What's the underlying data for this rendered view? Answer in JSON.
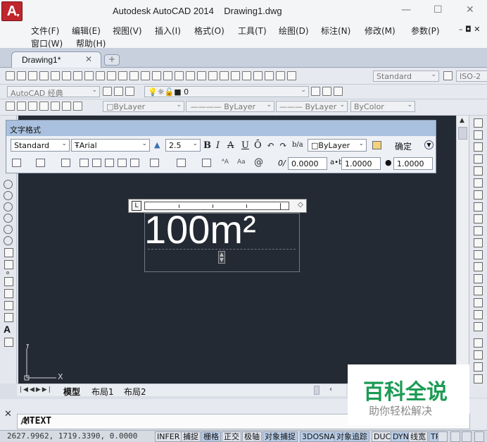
{
  "app": {
    "title": "Autodesk AutoCAD 2014    Drawing1.dwg",
    "logo_letter": "A",
    "brand_color": "#c0262d"
  },
  "window_controls": {
    "minimize": "—",
    "maximize": "☐",
    "close": "✕"
  },
  "menu": {
    "row1": [
      "文件(F)",
      "编辑(E)",
      "视图(V)",
      "插入(I)",
      "格式(O)",
      "工具(T)",
      "绘图(D)",
      "标注(N)",
      "修改(M)",
      "参数(P)"
    ],
    "row2": [
      "窗口(W)",
      "帮助(H)"
    ],
    "doc_controls": "– ◘ ✕"
  },
  "tabs": {
    "active": "Drawing1*",
    "close": "✕",
    "new": "+"
  },
  "toolbars": {
    "text_style": "Standard",
    "dim_style": "ISO-2",
    "workspace": "AutoCAD 经典",
    "layer": "0",
    "color": "ByLayer",
    "linetype": "ByLayer",
    "lineweight": "ByLayer",
    "plotstyle": "ByColor"
  },
  "text_format": {
    "title": "文字格式",
    "style": "Standard",
    "font": "Arial",
    "height": "2.5",
    "bold": "B",
    "italic": "I",
    "strike": "A",
    "underline": "U",
    "overline": "Ō",
    "undo": "↶",
    "redo": "↷",
    "stack": "b/a",
    "color": "ByLayer",
    "ok": "确定",
    "oblique": "0.0000",
    "tracking": "1.0000",
    "width_factor": "1.0000"
  },
  "mtext_content": "100m²",
  "layout_tabs": [
    "模型",
    "布局1",
    "布局2"
  ],
  "command": {
    "prompt_icon": "A",
    "text": "MTEXT",
    "close": "✕"
  },
  "coordinates": "2627.9962, 1719.3390, 0.0000",
  "status_buttons": [
    {
      "label": "INFER",
      "on": false
    },
    {
      "label": "捕捉",
      "on": false
    },
    {
      "label": "栅格",
      "on": true
    },
    {
      "label": "正交",
      "on": false
    },
    {
      "label": "极轴",
      "on": false
    },
    {
      "label": "对象捕捉",
      "on": true
    },
    {
      "label": "3DOSNAP",
      "on": true
    },
    {
      "label": "对象追踪",
      "on": true
    },
    {
      "label": "DUCS",
      "on": false
    },
    {
      "label": "DYN",
      "on": true
    },
    {
      "label": "线宽",
      "on": false
    },
    {
      "label": "TPY",
      "on": true
    }
  ],
  "ucs": {
    "x": "X",
    "y": "Y"
  },
  "watermark": {
    "title": "百科全说",
    "subtitle": "助你轻松解决"
  }
}
